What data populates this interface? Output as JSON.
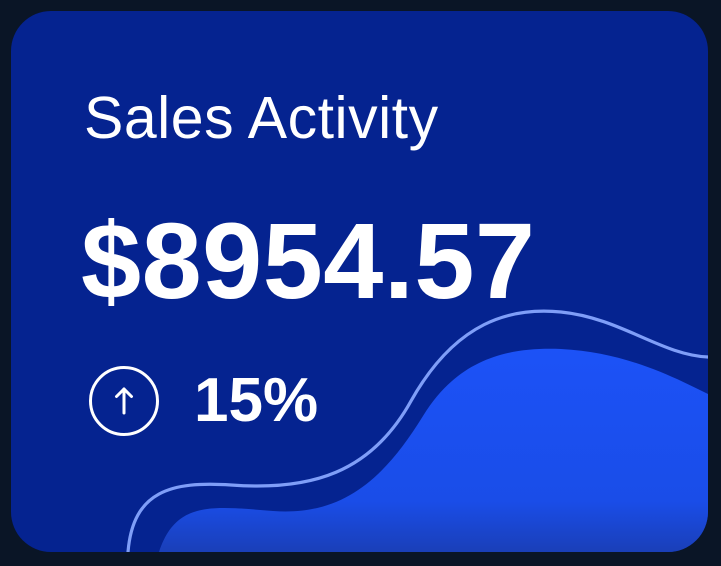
{
  "card": {
    "title": "Sales Activity",
    "amount": "$8954.57",
    "change": {
      "icon": "arrow-up-circle-icon",
      "direction": "up",
      "value": "15%"
    }
  },
  "colors": {
    "page_background": "#0a1526",
    "card_background": "#052390",
    "wave_fill": "#1a4ff2",
    "wave_line": "#7f9ef8",
    "text": "#ffffff"
  }
}
